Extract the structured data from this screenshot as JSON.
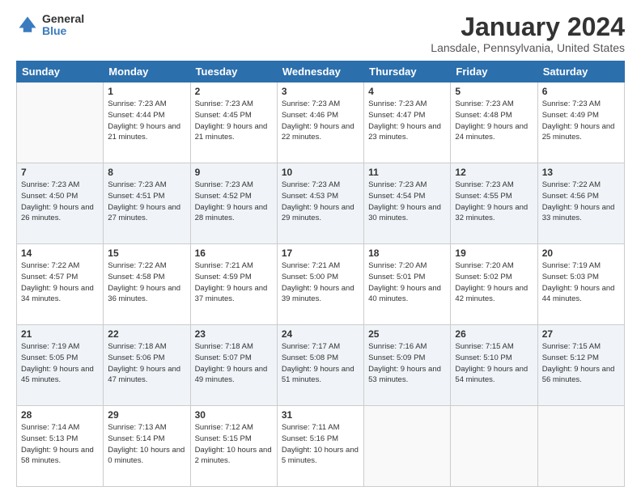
{
  "logo": {
    "general": "General",
    "blue": "Blue"
  },
  "title": "January 2024",
  "location": "Lansdale, Pennsylvania, United States",
  "days_of_week": [
    "Sunday",
    "Monday",
    "Tuesday",
    "Wednesday",
    "Thursday",
    "Friday",
    "Saturday"
  ],
  "weeks": [
    [
      {
        "day": "",
        "empty": true
      },
      {
        "day": "1",
        "sunrise": "7:23 AM",
        "sunset": "4:44 PM",
        "daylight": "9 hours and 21 minutes."
      },
      {
        "day": "2",
        "sunrise": "7:23 AM",
        "sunset": "4:45 PM",
        "daylight": "9 hours and 21 minutes."
      },
      {
        "day": "3",
        "sunrise": "7:23 AM",
        "sunset": "4:46 PM",
        "daylight": "9 hours and 22 minutes."
      },
      {
        "day": "4",
        "sunrise": "7:23 AM",
        "sunset": "4:47 PM",
        "daylight": "9 hours and 23 minutes."
      },
      {
        "day": "5",
        "sunrise": "7:23 AM",
        "sunset": "4:48 PM",
        "daylight": "9 hours and 24 minutes."
      },
      {
        "day": "6",
        "sunrise": "7:23 AM",
        "sunset": "4:49 PM",
        "daylight": "9 hours and 25 minutes."
      }
    ],
    [
      {
        "day": "7",
        "sunrise": "7:23 AM",
        "sunset": "4:50 PM",
        "daylight": "9 hours and 26 minutes."
      },
      {
        "day": "8",
        "sunrise": "7:23 AM",
        "sunset": "4:51 PM",
        "daylight": "9 hours and 27 minutes."
      },
      {
        "day": "9",
        "sunrise": "7:23 AM",
        "sunset": "4:52 PM",
        "daylight": "9 hours and 28 minutes."
      },
      {
        "day": "10",
        "sunrise": "7:23 AM",
        "sunset": "4:53 PM",
        "daylight": "9 hours and 29 minutes."
      },
      {
        "day": "11",
        "sunrise": "7:23 AM",
        "sunset": "4:54 PM",
        "daylight": "9 hours and 30 minutes."
      },
      {
        "day": "12",
        "sunrise": "7:23 AM",
        "sunset": "4:55 PM",
        "daylight": "9 hours and 32 minutes."
      },
      {
        "day": "13",
        "sunrise": "7:22 AM",
        "sunset": "4:56 PM",
        "daylight": "9 hours and 33 minutes."
      }
    ],
    [
      {
        "day": "14",
        "sunrise": "7:22 AM",
        "sunset": "4:57 PM",
        "daylight": "9 hours and 34 minutes."
      },
      {
        "day": "15",
        "sunrise": "7:22 AM",
        "sunset": "4:58 PM",
        "daylight": "9 hours and 36 minutes."
      },
      {
        "day": "16",
        "sunrise": "7:21 AM",
        "sunset": "4:59 PM",
        "daylight": "9 hours and 37 minutes."
      },
      {
        "day": "17",
        "sunrise": "7:21 AM",
        "sunset": "5:00 PM",
        "daylight": "9 hours and 39 minutes."
      },
      {
        "day": "18",
        "sunrise": "7:20 AM",
        "sunset": "5:01 PM",
        "daylight": "9 hours and 40 minutes."
      },
      {
        "day": "19",
        "sunrise": "7:20 AM",
        "sunset": "5:02 PM",
        "daylight": "9 hours and 42 minutes."
      },
      {
        "day": "20",
        "sunrise": "7:19 AM",
        "sunset": "5:03 PM",
        "daylight": "9 hours and 44 minutes."
      }
    ],
    [
      {
        "day": "21",
        "sunrise": "7:19 AM",
        "sunset": "5:05 PM",
        "daylight": "9 hours and 45 minutes."
      },
      {
        "day": "22",
        "sunrise": "7:18 AM",
        "sunset": "5:06 PM",
        "daylight": "9 hours and 47 minutes."
      },
      {
        "day": "23",
        "sunrise": "7:18 AM",
        "sunset": "5:07 PM",
        "daylight": "9 hours and 49 minutes."
      },
      {
        "day": "24",
        "sunrise": "7:17 AM",
        "sunset": "5:08 PM",
        "daylight": "9 hours and 51 minutes."
      },
      {
        "day": "25",
        "sunrise": "7:16 AM",
        "sunset": "5:09 PM",
        "daylight": "9 hours and 53 minutes."
      },
      {
        "day": "26",
        "sunrise": "7:15 AM",
        "sunset": "5:10 PM",
        "daylight": "9 hours and 54 minutes."
      },
      {
        "day": "27",
        "sunrise": "7:15 AM",
        "sunset": "5:12 PM",
        "daylight": "9 hours and 56 minutes."
      }
    ],
    [
      {
        "day": "28",
        "sunrise": "7:14 AM",
        "sunset": "5:13 PM",
        "daylight": "9 hours and 58 minutes."
      },
      {
        "day": "29",
        "sunrise": "7:13 AM",
        "sunset": "5:14 PM",
        "daylight": "10 hours and 0 minutes."
      },
      {
        "day": "30",
        "sunrise": "7:12 AM",
        "sunset": "5:15 PM",
        "daylight": "10 hours and 2 minutes."
      },
      {
        "day": "31",
        "sunrise": "7:11 AM",
        "sunset": "5:16 PM",
        "daylight": "10 hours and 5 minutes."
      },
      {
        "day": "",
        "empty": true
      },
      {
        "day": "",
        "empty": true
      },
      {
        "day": "",
        "empty": true
      }
    ]
  ]
}
